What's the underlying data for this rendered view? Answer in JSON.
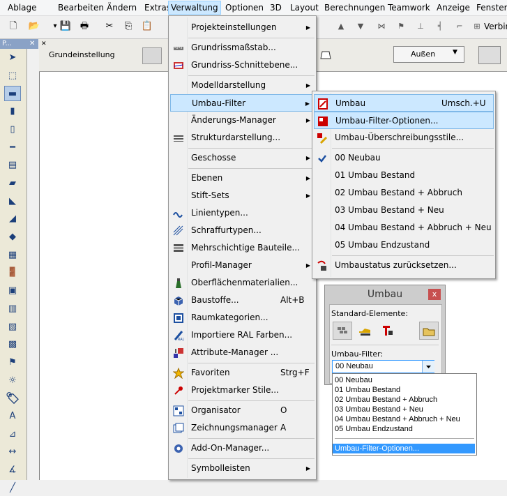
{
  "menubar": [
    "Ablage",
    "Bearbeiten",
    "Ändern",
    "Extras",
    "Verwaltung",
    "Optionen",
    "3D",
    "Layout",
    "Berechnungen",
    "Teamwork",
    "Anzeige",
    "Fenster"
  ],
  "toolbox": {
    "title": "P...",
    "close": "✕"
  },
  "infobox": {
    "label": "Grundeinstellung",
    "dropdown_value": "Außen"
  },
  "toolbar_right_label": "Verbin",
  "verwaltung_menu": [
    {
      "label": "Projekteinstellungen",
      "submenu": true
    },
    {
      "sep": true
    },
    {
      "label": "Grundrissmaßstab..."
    },
    {
      "label": "Grundriss-Schnittebene..."
    },
    {
      "sep": true
    },
    {
      "label": "Modelldarstellung",
      "submenu": true
    },
    {
      "label": "Umbau-Filter",
      "submenu": true,
      "highlight": true
    },
    {
      "label": "Änderungs-Manager",
      "submenu": true
    },
    {
      "label": "Strukturdarstellung..."
    },
    {
      "sep": true
    },
    {
      "label": "Geschosse",
      "submenu": true
    },
    {
      "sep": true
    },
    {
      "label": "Ebenen",
      "submenu": true
    },
    {
      "label": "Stift-Sets",
      "submenu": true
    },
    {
      "label": "Linientypen..."
    },
    {
      "label": "Schraffurtypen..."
    },
    {
      "label": "Mehrschichtige Bauteile..."
    },
    {
      "label": "Profil-Manager",
      "submenu": true
    },
    {
      "label": "Oberflächenmaterialien..."
    },
    {
      "label": "Baustoffe...",
      "shortcut": "Alt+B"
    },
    {
      "label": "Raumkategorien..."
    },
    {
      "label": "Importiere RAL Farben..."
    },
    {
      "label": "Attribute-Manager ..."
    },
    {
      "sep": true
    },
    {
      "label": "Favoriten",
      "shortcut": "Strg+F"
    },
    {
      "label": "Projektmarker Stile..."
    },
    {
      "sep": true
    },
    {
      "label": "Organisator",
      "shortcut": "O"
    },
    {
      "label": "Zeichnungsmanager",
      "shortcut": "A"
    },
    {
      "sep": true
    },
    {
      "label": "Add-On-Manager..."
    },
    {
      "sep": true
    },
    {
      "label": "Symbolleisten",
      "submenu": true
    }
  ],
  "umbau_submenu": [
    {
      "label": "Umbau",
      "shortcut": "Umsch.+U",
      "highlight": true
    },
    {
      "label": "Umbau-Filter-Optionen...",
      "highlight": true
    },
    {
      "label": "Umbau-Überschreibungsstile..."
    },
    {
      "sep": true
    },
    {
      "label": "00 Neubau",
      "checked": true
    },
    {
      "label": "01 Umbau Bestand"
    },
    {
      "label": "02 Umbau Bestand + Abbruch"
    },
    {
      "label": "03 Umbau Bestand + Neu"
    },
    {
      "label": "04 Umbau Bestand + Abbruch + Neu"
    },
    {
      "label": "05 Umbau Endzustand"
    },
    {
      "sep": true
    },
    {
      "label": "Umbaustatus zurücksetzen..."
    }
  ],
  "palette": {
    "title": "Umbau",
    "close": "x",
    "standard_label": "Standard-Elemente:",
    "filter_label": "Umbau-Filter:",
    "selected": "00 Neubau",
    "options": [
      "00 Neubau",
      "01 Umbau Bestand",
      "02 Umbau Bestand + Abbruch",
      "03 Umbau Bestand + Neu",
      "04 Umbau Bestand + Abbruch + Neu",
      "05 Umbau Endzustand"
    ],
    "options_footer": "Umbau-Filter-Optionen..."
  },
  "colors": {
    "highlight": "#cce8ff",
    "highlight_border": "#7fb8e8",
    "selection": "#3399ff",
    "menu_bg": "#f0f0f0"
  }
}
